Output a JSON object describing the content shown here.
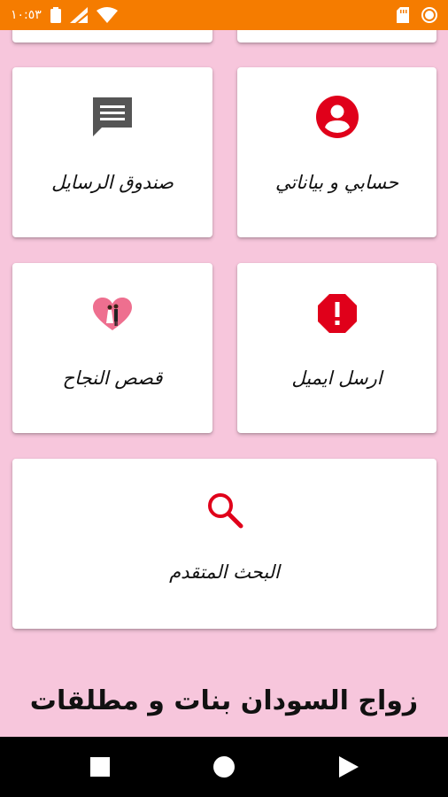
{
  "status_bar": {
    "time": "١٠:٥٣",
    "icons": [
      "battery-icon",
      "signal-icon",
      "wifi-icon",
      "sd-card-icon",
      "circle-status-icon"
    ]
  },
  "tiles": [
    {
      "label": "حسابي و بياناتي",
      "icon": "account-circle-icon"
    },
    {
      "label": "صندوق الرسايل",
      "icon": "message-icon"
    },
    {
      "label": "ارسل ايميل",
      "icon": "alert-octagon-icon"
    },
    {
      "label": "قصص النجاح",
      "icon": "couple-heart-icon"
    },
    {
      "label": "البحث المتقدم",
      "icon": "search-icon"
    }
  ],
  "app_title": "زواج السودان بنات و مطلقات",
  "nav": {
    "buttons": [
      "recents-button",
      "home-button",
      "back-button"
    ]
  },
  "colors": {
    "status_bar": "#f57c00",
    "background": "#f7c6dc",
    "icon_red": "#e0001a",
    "icon_grey": "#555555"
  }
}
